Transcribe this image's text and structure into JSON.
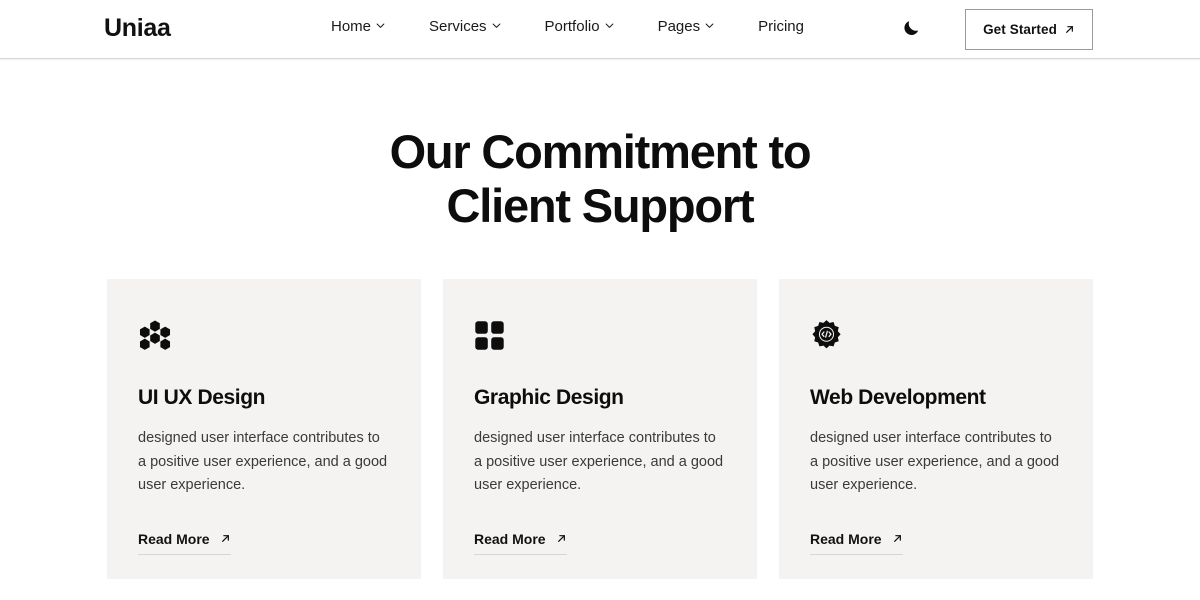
{
  "header": {
    "brand": "Uniaa",
    "nav_items": [
      {
        "label": "Home",
        "icon": "chevron-down-icon",
        "has_dropdown": true
      },
      {
        "label": "Services",
        "icon": "chevron-down-icon",
        "has_dropdown": true
      },
      {
        "label": "Portfolio",
        "icon": "chevron-down-icon",
        "has_dropdown": true
      },
      {
        "label": "Pages",
        "icon": "chevron-down-icon",
        "has_dropdown": true
      },
      {
        "label": "Pricing",
        "icon": "",
        "has_dropdown": false
      }
    ],
    "theme_toggle_icon": "moon-icon",
    "cta": {
      "label": "Get Started",
      "icon": "arrow-up-right-icon"
    }
  },
  "main": {
    "heading_line_1": "Our Commitment to",
    "heading_line_2": "Client Support",
    "cards": [
      {
        "icon": "honeycomb-icon",
        "title": "UI UX Design",
        "description": "designed user interface contributes to a positive user experience, and a good user experience.",
        "link_label": "Read More",
        "link_icon": "arrow-up-right-icon"
      },
      {
        "icon": "grid-squares-icon",
        "title": "Graphic Design",
        "description": "designed user interface contributes to a positive user experience, and a good user experience.",
        "link_label": "Read More",
        "link_icon": "arrow-up-right-icon"
      },
      {
        "icon": "gear-code-icon",
        "title": "Web Development",
        "description": "designed user interface contributes to a positive user experience, and a good user experience.",
        "link_label": "Read More",
        "link_icon": "arrow-up-right-icon"
      }
    ]
  },
  "colors": {
    "page_background": "#ffffff",
    "card_background": "#f4f3f1",
    "text_primary": "#0d0d0d",
    "text_secondary": "#3a3a3a",
    "border": "#d6d6d6",
    "underline": "#d8d6d2"
  }
}
